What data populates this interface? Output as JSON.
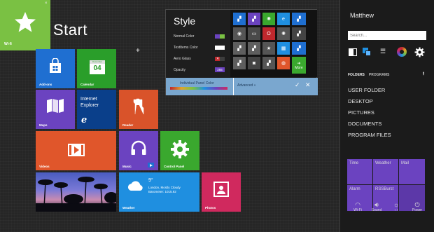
{
  "start": {
    "title": "Start",
    "pinned": {
      "label": "Wi-fi",
      "close": "×"
    },
    "add_symbol": "+"
  },
  "tiles": {
    "add_ons": "Add-ons",
    "calendar": "Calendar",
    "calendar_month": "December",
    "calendar_day": "04",
    "maps": "Maps",
    "ie_line1": "Internet",
    "ie_line2": "Explorer",
    "reader": "Reader",
    "videos": "Videos",
    "music": "Music",
    "control_panel": "Control Panel",
    "weather": "Weather",
    "weather_temp": "9°",
    "weather_location": "London, Mostly Cloudy",
    "weather_barometer": "Barometer: 1015.92",
    "photos": "Photos"
  },
  "style_dialog": {
    "title": "Style",
    "rows": [
      {
        "label": "Normal Color"
      },
      {
        "label": "TextItems Color"
      },
      {
        "label": "Aero Glass"
      },
      {
        "label": "Opacity",
        "value": "255"
      }
    ],
    "individual_label": "Individual Panel Color",
    "advanced_label": "Advanced »",
    "more_label": "More",
    "accent_colors": [
      "#6b43c0",
      "#7ac143",
      "#00a1e4",
      "#e0562b",
      "#1f6fd1"
    ]
  },
  "panel": {
    "username": "Matthew",
    "search_placeholder": "Search...",
    "tab_folders": "FOLDERS",
    "tab_programs": "PROGRAMS",
    "pin_icon": "pin-icon",
    "items": [
      "USER FOLDER",
      "DESKTOP",
      "PICTURES",
      "DOCUMENTS",
      "PROGRAM FILES"
    ],
    "widgets": {
      "time": "Time",
      "weather": "Weather",
      "mail": "Mail",
      "alarm": "Alarm",
      "rss": "RSSBurst"
    },
    "quick": {
      "wifi": "Wi-Fi",
      "sound": "Sound",
      "brightness_arrows": "‹   ›",
      "power": "Power"
    }
  }
}
